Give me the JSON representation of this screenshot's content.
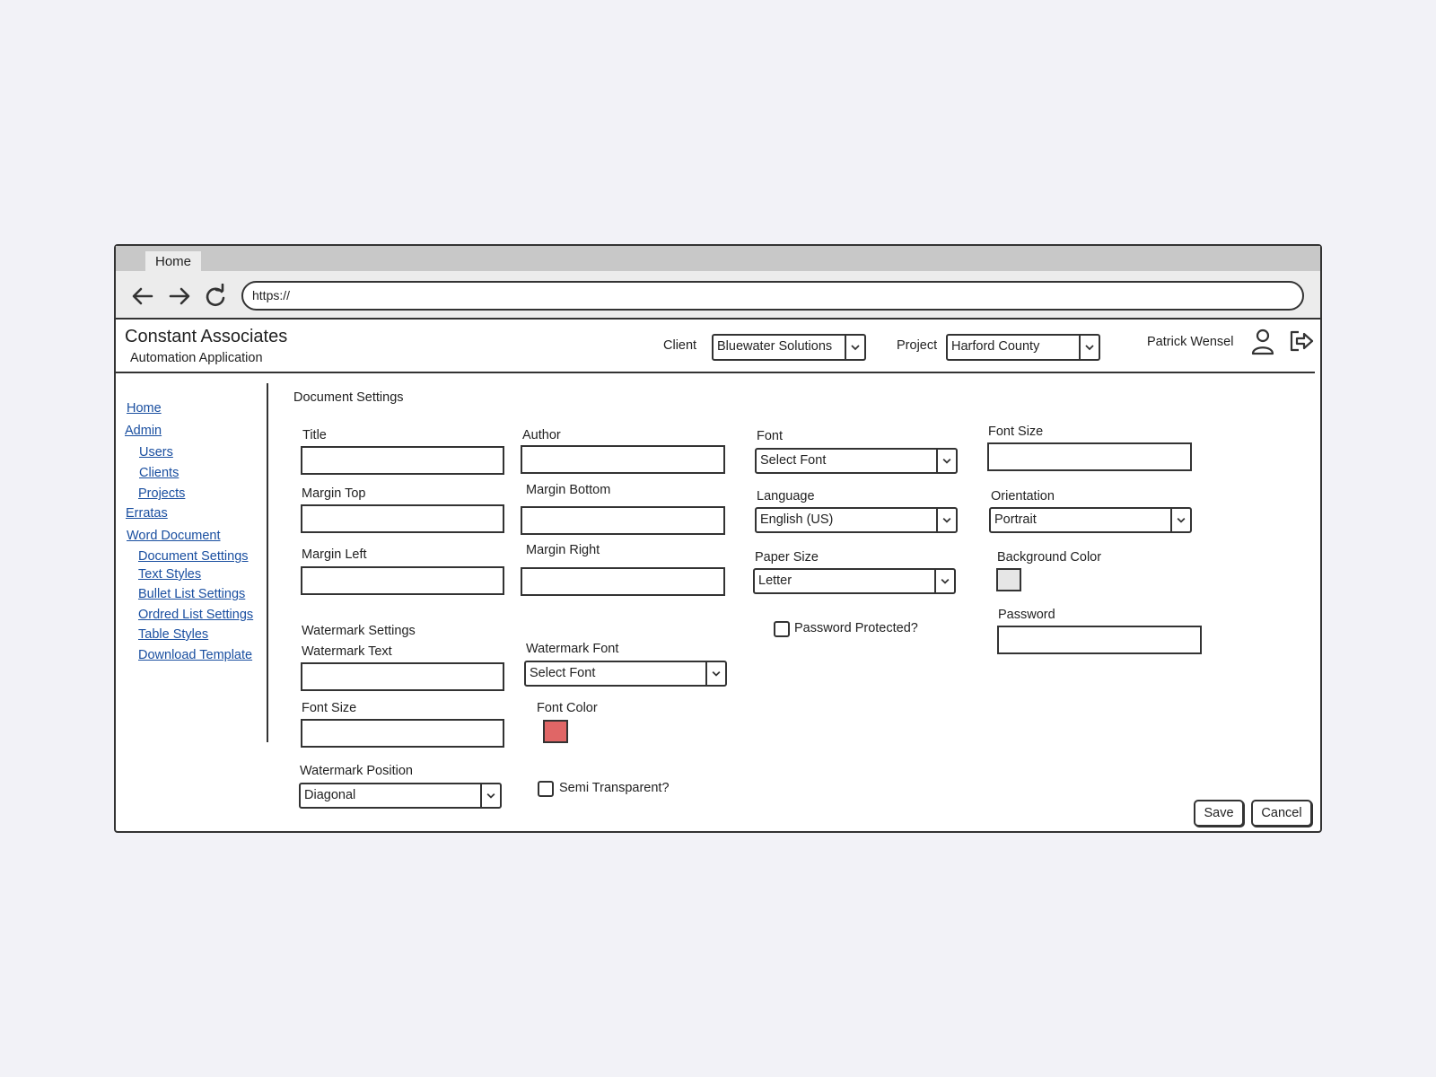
{
  "browser": {
    "tab_label": "Home",
    "url": "https://"
  },
  "header": {
    "brand": "Constant Associates",
    "subtitle": "Automation Application",
    "client_label": "Client",
    "client_value": "Bluewater Solutions",
    "project_label": "Project",
    "project_value": "Harford County",
    "user_name": "Patrick Wensel"
  },
  "sidebar": {
    "items": [
      {
        "label": "Home"
      },
      {
        "label": "Admin"
      },
      {
        "label": "Users"
      },
      {
        "label": "Clients"
      },
      {
        "label": "Projects"
      },
      {
        "label": "Erratas"
      },
      {
        "label": "Word Document"
      },
      {
        "label": "Document Settings"
      },
      {
        "label": "Text Styles"
      },
      {
        "label": "Bullet List Settings"
      },
      {
        "label": "Ordred List Settings"
      },
      {
        "label": "Table Styles"
      },
      {
        "label": "Download Template"
      }
    ]
  },
  "form": {
    "section_title": "Document Settings",
    "title_label": "Title",
    "author_label": "Author",
    "font_label": "Font",
    "font_value": "Select Font",
    "font_size_label": "Font Size",
    "margin_top_label": "Margin Top",
    "margin_bottom_label": "Margin Bottom",
    "language_label": "Language",
    "language_value": "English (US)",
    "orientation_label": "Orientation",
    "orientation_value": "Portrait",
    "margin_left_label": "Margin Left",
    "margin_right_label": "Margin Right",
    "paper_size_label": "Paper Size",
    "paper_size_value": "Letter",
    "background_color_label": "Background Color",
    "background_color": "#e6e6e6",
    "password_protected_label": "Password Protected?",
    "password_label": "Password",
    "watermark_section": "Watermark Settings",
    "watermark_text_label": "Watermark Text",
    "watermark_font_label": "Watermark Font",
    "watermark_font_value": "Select Font",
    "wm_font_size_label": "Font Size",
    "font_color_label": "Font Color",
    "font_color": "#e06666",
    "watermark_position_label": "Watermark Position",
    "watermark_position_value": "Diagonal",
    "semi_transparent_label": "Semi Transparent?"
  },
  "actions": {
    "save_label": "Save",
    "cancel_label": "Cancel"
  }
}
